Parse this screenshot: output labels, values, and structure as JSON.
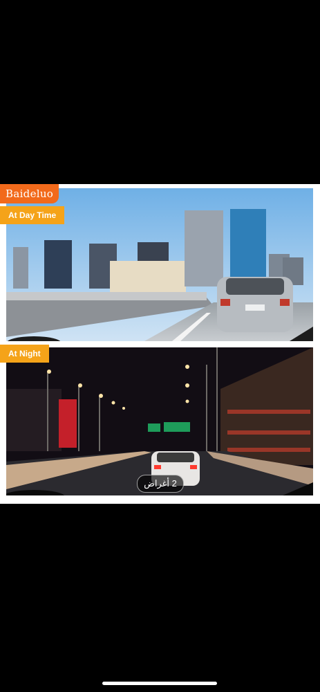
{
  "brand": "Baideluo",
  "labels": {
    "day": "At Day Time",
    "night": "At Night"
  },
  "image_counter": "2 أغراض",
  "colors": {
    "brand_bg": "#f26a1b",
    "tag_bg": "#f5a319",
    "page_bg": "#000000"
  }
}
